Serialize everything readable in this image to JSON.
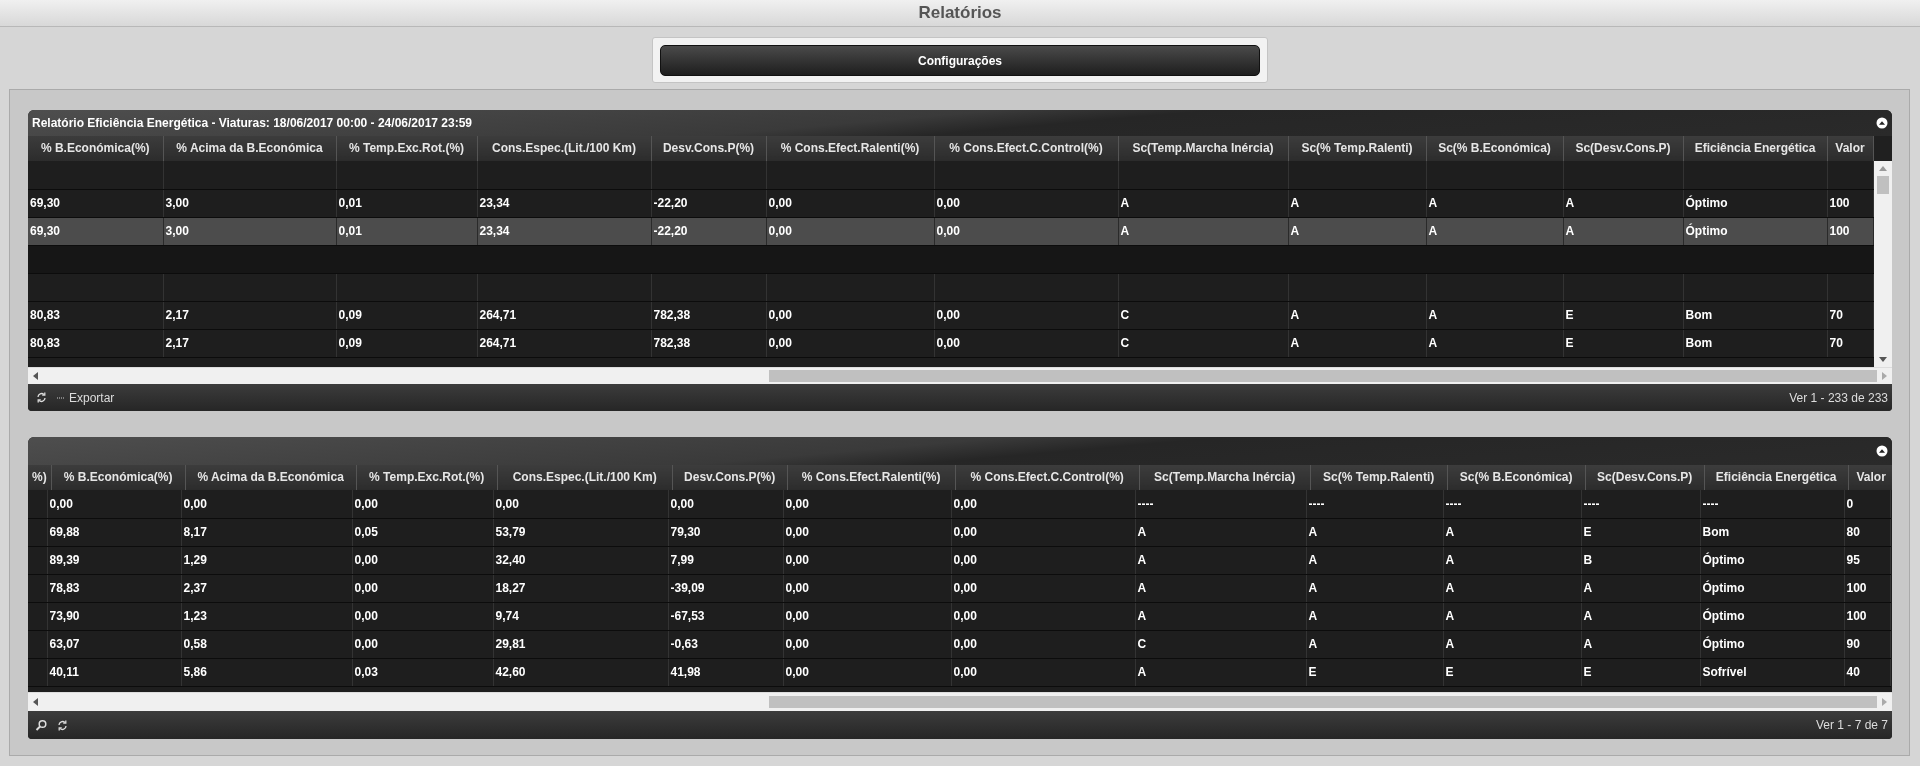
{
  "window": {
    "title": "Relatórios"
  },
  "toolbar": {
    "button": "Configurações"
  },
  "grids": [
    {
      "caption": "Relatório Eficiência Energética - Viaturas: 18/06/2017 00:00 - 24/06/2017 23:59",
      "vertical_scrollbar": true,
      "columns": [
        "% B.Económica(%)",
        "% Acima da B.Económica",
        "% Temp.Exc.Rot.(%)",
        "Cons.Espec.(Lit./100 Km)",
        "Desv.Cons.P(%)",
        "% Cons.Efect.Ralenti(%)",
        "% Cons.Efect.C.Control(%)",
        "Sc(Temp.Marcha Inércia)",
        "Sc(% Temp.Ralenti)",
        "Sc(% B.Económica)",
        "Sc(Desv.Cons.P)",
        "Eficiência Energética",
        "Valor"
      ],
      "rows": [
        {
          "kind": "blank",
          "selected": false
        },
        {
          "kind": "data",
          "selected": false,
          "cells": [
            "69,30",
            "3,00",
            "0,01",
            "23,34",
            "-22,20",
            "0,00",
            "0,00",
            "A",
            "A",
            "A",
            "A",
            "Óptimo",
            "100"
          ]
        },
        {
          "kind": "data",
          "selected": true,
          "cells": [
            "69,30",
            "3,00",
            "0,01",
            "23,34",
            "-22,20",
            "0,00",
            "0,00",
            "A",
            "A",
            "A",
            "A",
            "Óptimo",
            "100"
          ]
        },
        {
          "kind": "group",
          "selected": false
        },
        {
          "kind": "blank",
          "selected": false
        },
        {
          "kind": "data",
          "selected": false,
          "cells": [
            "80,83",
            "2,17",
            "0,09",
            "264,71",
            "782,38",
            "0,00",
            "0,00",
            "C",
            "A",
            "A",
            "E",
            "Bom",
            "70"
          ]
        },
        {
          "kind": "data",
          "selected": false,
          "cells": [
            "80,83",
            "2,17",
            "0,09",
            "264,71",
            "782,38",
            "0,00",
            "0,00",
            "C",
            "A",
            "A",
            "E",
            "Bom",
            "70"
          ]
        }
      ],
      "footer": {
        "tools": [
          {
            "kind": "refresh"
          },
          {
            "kind": "export",
            "label": "Exportar"
          }
        ],
        "pager": "Ver 1 - 233 de 233"
      }
    },
    {
      "vertical_scrollbar": false,
      "columns": [
        "%)",
        "% B.Económica(%)",
        "% Acima da B.Económica",
        "% Temp.Exc.Rot.(%)",
        "Cons.Espec.(Lit./100 Km)",
        "Desv.Cons.P(%)",
        "% Cons.Efect.Ralenti(%)",
        "% Cons.Efect.C.Control(%)",
        "Sc(Temp.Marcha Inércia)",
        "Sc(% Temp.Ralenti)",
        "Sc(% B.Económica)",
        "Sc(Desv.Cons.P)",
        "Eficiência Energética",
        "Valor"
      ],
      "rows": [
        {
          "kind": "data",
          "selected": false,
          "cells": [
            "",
            "0,00",
            "0,00",
            "0,00",
            "0,00",
            "0,00",
            "0,00",
            "0,00",
            "----",
            "----",
            "----",
            "----",
            "----",
            "0"
          ]
        },
        {
          "kind": "data",
          "selected": false,
          "cells": [
            "",
            "69,88",
            "8,17",
            "0,05",
            "53,79",
            "79,30",
            "0,00",
            "0,00",
            "A",
            "A",
            "A",
            "E",
            "Bom",
            "80"
          ]
        },
        {
          "kind": "data",
          "selected": false,
          "cells": [
            "",
            "89,39",
            "1,29",
            "0,00",
            "32,40",
            "7,99",
            "0,00",
            "0,00",
            "A",
            "A",
            "A",
            "B",
            "Óptimo",
            "95"
          ]
        },
        {
          "kind": "data",
          "selected": false,
          "cells": [
            "",
            "78,83",
            "2,37",
            "0,00",
            "18,27",
            "-39,09",
            "0,00",
            "0,00",
            "A",
            "A",
            "A",
            "A",
            "Óptimo",
            "100"
          ]
        },
        {
          "kind": "data",
          "selected": false,
          "cells": [
            "",
            "73,90",
            "1,23",
            "0,00",
            "9,74",
            "-67,53",
            "0,00",
            "0,00",
            "A",
            "A",
            "A",
            "A",
            "Óptimo",
            "100"
          ]
        },
        {
          "kind": "data",
          "selected": false,
          "cells": [
            "",
            "63,07",
            "0,58",
            "0,00",
            "29,81",
            "-0,63",
            "0,00",
            "0,00",
            "C",
            "A",
            "A",
            "A",
            "Óptimo",
            "90"
          ]
        },
        {
          "kind": "data",
          "selected": false,
          "cells": [
            "",
            "40,11",
            "5,86",
            "0,03",
            "42,60",
            "41,98",
            "0,00",
            "0,00",
            "A",
            "E",
            "E",
            "E",
            "Sofrível",
            "40"
          ]
        }
      ],
      "footer": {
        "tools": [
          {
            "kind": "search"
          },
          {
            "kind": "refresh"
          }
        ],
        "pager": "Ver 1 - 7 de 7"
      }
    }
  ]
}
